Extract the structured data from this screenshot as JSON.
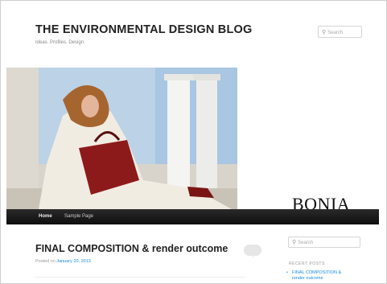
{
  "site": {
    "title": "THE ENVIRONMENTAL DESIGN BLOG",
    "tagline": "Ideas. Profiles. Design",
    "search_placeholder": "Search"
  },
  "banner": {
    "brand": "BONIA"
  },
  "nav": {
    "items": [
      {
        "label": "Home"
      },
      {
        "label": "Sample Page"
      }
    ]
  },
  "post": {
    "title": "FINAL COMPOSITION & render outcome",
    "meta_prefix": "Posted on",
    "date": "January 20, 2013"
  },
  "sidebar": {
    "search_placeholder": "Search",
    "recent_heading": "RECENT POSTS",
    "recent_posts": [
      {
        "line1": "FINAL COMPOSITION &",
        "line2": "render outcome"
      }
    ]
  },
  "colors": {
    "link": "#1b8be0",
    "navbar": "#111111",
    "title": "#222222"
  }
}
